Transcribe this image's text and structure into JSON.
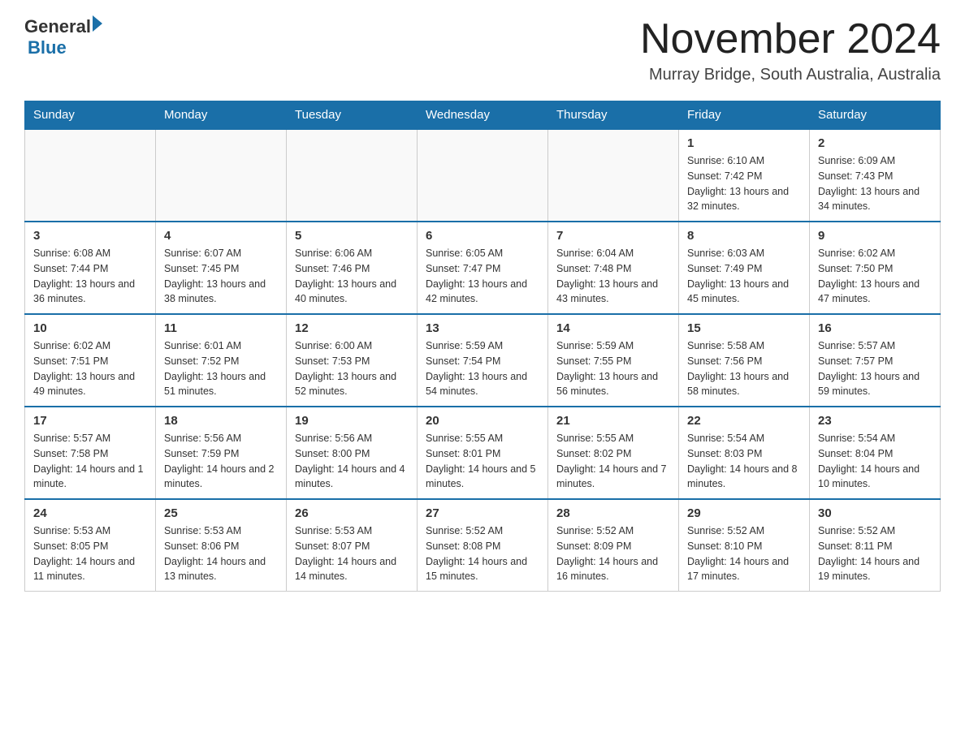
{
  "logo": {
    "general": "General",
    "blue": "Blue"
  },
  "title": "November 2024",
  "location": "Murray Bridge, South Australia, Australia",
  "days_of_week": [
    "Sunday",
    "Monday",
    "Tuesday",
    "Wednesday",
    "Thursday",
    "Friday",
    "Saturday"
  ],
  "weeks": [
    [
      {
        "day": "",
        "info": ""
      },
      {
        "day": "",
        "info": ""
      },
      {
        "day": "",
        "info": ""
      },
      {
        "day": "",
        "info": ""
      },
      {
        "day": "",
        "info": ""
      },
      {
        "day": "1",
        "info": "Sunrise: 6:10 AM\nSunset: 7:42 PM\nDaylight: 13 hours and 32 minutes."
      },
      {
        "day": "2",
        "info": "Sunrise: 6:09 AM\nSunset: 7:43 PM\nDaylight: 13 hours and 34 minutes."
      }
    ],
    [
      {
        "day": "3",
        "info": "Sunrise: 6:08 AM\nSunset: 7:44 PM\nDaylight: 13 hours and 36 minutes."
      },
      {
        "day": "4",
        "info": "Sunrise: 6:07 AM\nSunset: 7:45 PM\nDaylight: 13 hours and 38 minutes."
      },
      {
        "day": "5",
        "info": "Sunrise: 6:06 AM\nSunset: 7:46 PM\nDaylight: 13 hours and 40 minutes."
      },
      {
        "day": "6",
        "info": "Sunrise: 6:05 AM\nSunset: 7:47 PM\nDaylight: 13 hours and 42 minutes."
      },
      {
        "day": "7",
        "info": "Sunrise: 6:04 AM\nSunset: 7:48 PM\nDaylight: 13 hours and 43 minutes."
      },
      {
        "day": "8",
        "info": "Sunrise: 6:03 AM\nSunset: 7:49 PM\nDaylight: 13 hours and 45 minutes."
      },
      {
        "day": "9",
        "info": "Sunrise: 6:02 AM\nSunset: 7:50 PM\nDaylight: 13 hours and 47 minutes."
      }
    ],
    [
      {
        "day": "10",
        "info": "Sunrise: 6:02 AM\nSunset: 7:51 PM\nDaylight: 13 hours and 49 minutes."
      },
      {
        "day": "11",
        "info": "Sunrise: 6:01 AM\nSunset: 7:52 PM\nDaylight: 13 hours and 51 minutes."
      },
      {
        "day": "12",
        "info": "Sunrise: 6:00 AM\nSunset: 7:53 PM\nDaylight: 13 hours and 52 minutes."
      },
      {
        "day": "13",
        "info": "Sunrise: 5:59 AM\nSunset: 7:54 PM\nDaylight: 13 hours and 54 minutes."
      },
      {
        "day": "14",
        "info": "Sunrise: 5:59 AM\nSunset: 7:55 PM\nDaylight: 13 hours and 56 minutes."
      },
      {
        "day": "15",
        "info": "Sunrise: 5:58 AM\nSunset: 7:56 PM\nDaylight: 13 hours and 58 minutes."
      },
      {
        "day": "16",
        "info": "Sunrise: 5:57 AM\nSunset: 7:57 PM\nDaylight: 13 hours and 59 minutes."
      }
    ],
    [
      {
        "day": "17",
        "info": "Sunrise: 5:57 AM\nSunset: 7:58 PM\nDaylight: 14 hours and 1 minute."
      },
      {
        "day": "18",
        "info": "Sunrise: 5:56 AM\nSunset: 7:59 PM\nDaylight: 14 hours and 2 minutes."
      },
      {
        "day": "19",
        "info": "Sunrise: 5:56 AM\nSunset: 8:00 PM\nDaylight: 14 hours and 4 minutes."
      },
      {
        "day": "20",
        "info": "Sunrise: 5:55 AM\nSunset: 8:01 PM\nDaylight: 14 hours and 5 minutes."
      },
      {
        "day": "21",
        "info": "Sunrise: 5:55 AM\nSunset: 8:02 PM\nDaylight: 14 hours and 7 minutes."
      },
      {
        "day": "22",
        "info": "Sunrise: 5:54 AM\nSunset: 8:03 PM\nDaylight: 14 hours and 8 minutes."
      },
      {
        "day": "23",
        "info": "Sunrise: 5:54 AM\nSunset: 8:04 PM\nDaylight: 14 hours and 10 minutes."
      }
    ],
    [
      {
        "day": "24",
        "info": "Sunrise: 5:53 AM\nSunset: 8:05 PM\nDaylight: 14 hours and 11 minutes."
      },
      {
        "day": "25",
        "info": "Sunrise: 5:53 AM\nSunset: 8:06 PM\nDaylight: 14 hours and 13 minutes."
      },
      {
        "day": "26",
        "info": "Sunrise: 5:53 AM\nSunset: 8:07 PM\nDaylight: 14 hours and 14 minutes."
      },
      {
        "day": "27",
        "info": "Sunrise: 5:52 AM\nSunset: 8:08 PM\nDaylight: 14 hours and 15 minutes."
      },
      {
        "day": "28",
        "info": "Sunrise: 5:52 AM\nSunset: 8:09 PM\nDaylight: 14 hours and 16 minutes."
      },
      {
        "day": "29",
        "info": "Sunrise: 5:52 AM\nSunset: 8:10 PM\nDaylight: 14 hours and 17 minutes."
      },
      {
        "day": "30",
        "info": "Sunrise: 5:52 AM\nSunset: 8:11 PM\nDaylight: 14 hours and 19 minutes."
      }
    ]
  ]
}
